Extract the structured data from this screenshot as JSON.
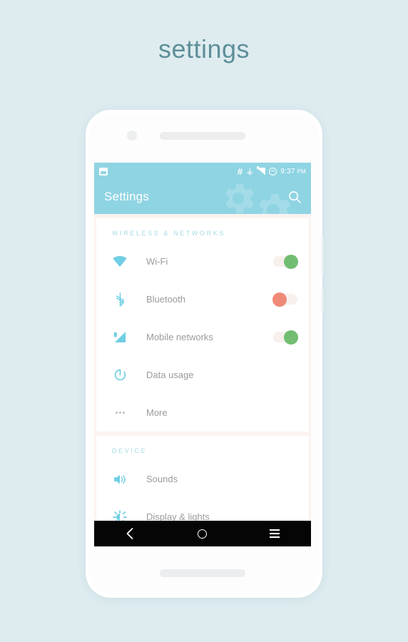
{
  "page": {
    "title": "settings",
    "background_color": "#deecf0",
    "title_color": "#5e8f99"
  },
  "device": {
    "accent_color": "#8fd4e3",
    "screen_background": "#fbf3f0"
  },
  "status_bar": {
    "left_icon": "screenshot-icon",
    "icons": [
      "hash-icon",
      "key-icon",
      "signal-icon",
      "battery-icon"
    ],
    "time": "9:37",
    "meridiem": "PM"
  },
  "toolbar": {
    "title": "Settings",
    "search_icon": "search-icon",
    "decoration": "gear-icon"
  },
  "sections": [
    {
      "header": "WIRELESS & NETWORKS",
      "rows": [
        {
          "label": "Wi-Fi",
          "icon": "wifi-icon",
          "control": "toggle",
          "state": "on",
          "knob_color": "#72bd72"
        },
        {
          "label": "Bluetooth",
          "icon": "bluetooth-icon",
          "control": "toggle",
          "state": "off",
          "knob_color": "#ef8a78"
        },
        {
          "label": "Mobile networks",
          "icon": "signal-icon",
          "control": "toggle",
          "state": "on",
          "knob_color": "#72bd72"
        },
        {
          "label": "Data usage",
          "icon": "data-usage-icon",
          "control": "none"
        },
        {
          "label": "More",
          "icon": "more-dots-icon",
          "control": "none"
        }
      ]
    },
    {
      "header": "DEVICE",
      "rows": [
        {
          "label": "Sounds",
          "icon": "speaker-icon",
          "control": "none"
        },
        {
          "label": "Display & lights",
          "icon": "brightness-icon",
          "control": "none"
        }
      ]
    }
  ],
  "navbar": {
    "back": "back-icon",
    "home": "home-icon",
    "menu": "menu-icon"
  }
}
